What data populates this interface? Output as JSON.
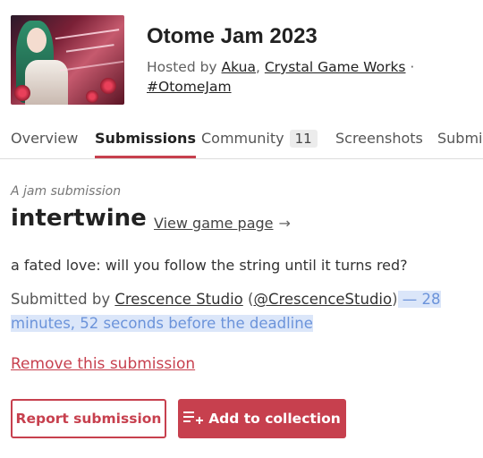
{
  "jam": {
    "title": "Otome Jam 2023",
    "hosted_by_prefix": "Hosted by ",
    "hosts": [
      "Akua",
      "Crystal Game Works"
    ],
    "host_sep": ", ",
    "dot": " ·",
    "hashtag": "#OtomeJam"
  },
  "tabs": [
    {
      "label": "Overview"
    },
    {
      "label": "Submissions"
    },
    {
      "label": "Community",
      "count": "11"
    },
    {
      "label": "Screenshots"
    },
    {
      "label": "Submis"
    }
  ],
  "submission": {
    "eyebrow": "A jam submission",
    "title": "intertwine",
    "view_page": "View game page",
    "view_arrow": "→",
    "tagline": "a fated love: will you follow the string until it turns red?",
    "submitted_prefix": "Submitted by ",
    "studio": "Crescence Studio",
    "handle_open": " (",
    "handle": "@CrescenceStudio",
    "handle_close": ")",
    "deadline_note": " — 28 minutes, 52 seconds before the deadline",
    "remove_link": "Remove this submission"
  },
  "buttons": {
    "report": "Report submission",
    "add_collection": "Add to collection"
  },
  "colors": {
    "accent": "#c7404e",
    "highlight": "#dbe6f9",
    "highlight_text": "#6b93da"
  }
}
